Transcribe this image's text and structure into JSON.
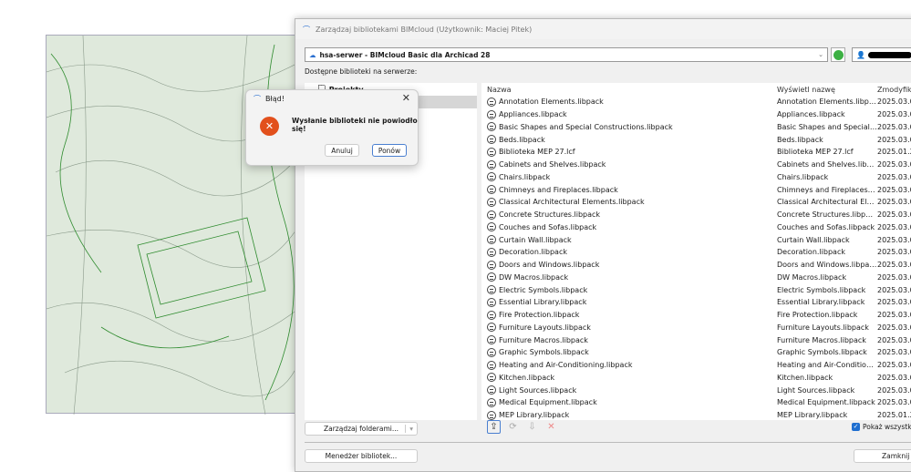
{
  "window": {
    "title": "Zarządzaj bibliotekami BIMcloud (Użytkownik: Maciej Pitek)"
  },
  "server": {
    "value": "hsa-serwer - BIMcloud Basic dla Archicad 28"
  },
  "available_label": "Dostępne biblioteki na serwerze:",
  "tree": {
    "root": "Projekty"
  },
  "columns": {
    "name": "Nazwa",
    "display": "Wyświetl nazwę",
    "modified": "Zmodyfik"
  },
  "libraries": [
    {
      "name": "Annotation Elements.libpack",
      "display": "Annotation Elements.libpack",
      "modified": "2025.03.0"
    },
    {
      "name": "Appliances.libpack",
      "display": "Appliances.libpack",
      "modified": "2025.03.0"
    },
    {
      "name": "Basic Shapes and Special Constructions.libpack",
      "display": "Basic Shapes and Special Cons...",
      "modified": "2025.03.0"
    },
    {
      "name": "Beds.libpack",
      "display": "Beds.libpack",
      "modified": "2025.03.0"
    },
    {
      "name": "Biblioteka MEP 27.lcf",
      "display": "Biblioteka MEP 27.lcf",
      "modified": "2025.01.2"
    },
    {
      "name": "Cabinets and Shelves.libpack",
      "display": "Cabinets and Shelves.libpack",
      "modified": "2025.03.0"
    },
    {
      "name": "Chairs.libpack",
      "display": "Chairs.libpack",
      "modified": "2025.03.0"
    },
    {
      "name": "Chimneys and Fireplaces.libpack",
      "display": "Chimneys and Fireplaces.libpack",
      "modified": "2025.03.0"
    },
    {
      "name": "Classical Architectural Elements.libpack",
      "display": "Classical Architectural Element...",
      "modified": "2025.03.0"
    },
    {
      "name": "Concrete Structures.libpack",
      "display": "Concrete Structures.libpack",
      "modified": "2025.03.0"
    },
    {
      "name": "Couches and Sofas.libpack",
      "display": "Couches and Sofas.libpack",
      "modified": "2025.03.0"
    },
    {
      "name": "Curtain Wall.libpack",
      "display": "Curtain Wall.libpack",
      "modified": "2025.03.0"
    },
    {
      "name": "Decoration.libpack",
      "display": "Decoration.libpack",
      "modified": "2025.03.0"
    },
    {
      "name": "Doors and Windows.libpack",
      "display": "Doors and Windows.libpack",
      "modified": "2025.03.0"
    },
    {
      "name": "DW Macros.libpack",
      "display": "DW Macros.libpack",
      "modified": "2025.03.0"
    },
    {
      "name": "Electric Symbols.libpack",
      "display": "Electric Symbols.libpack",
      "modified": "2025.03.0"
    },
    {
      "name": "Essential Library.libpack",
      "display": "Essential Library.libpack",
      "modified": "2025.03.0"
    },
    {
      "name": "Fire Protection.libpack",
      "display": "Fire Protection.libpack",
      "modified": "2025.03.0"
    },
    {
      "name": "Furniture Layouts.libpack",
      "display": "Furniture Layouts.libpack",
      "modified": "2025.03.0"
    },
    {
      "name": "Furniture Macros.libpack",
      "display": "Furniture Macros.libpack",
      "modified": "2025.03.0"
    },
    {
      "name": "Graphic Symbols.libpack",
      "display": "Graphic Symbols.libpack",
      "modified": "2025.03.0"
    },
    {
      "name": "Heating and Air-Conditioning.libpack",
      "display": "Heating and Air-Conditioning....",
      "modified": "2025.03.0"
    },
    {
      "name": "Kitchen.libpack",
      "display": "Kitchen.libpack",
      "modified": "2025.03.0"
    },
    {
      "name": "Light Sources.libpack",
      "display": "Light Sources.libpack",
      "modified": "2025.03.0"
    },
    {
      "name": "Medical Equipment.libpack",
      "display": "Medical Equipment.libpack",
      "modified": "2025.03.0"
    },
    {
      "name": "MEP Library.libpack",
      "display": "MEP Library.libpack",
      "modified": "2025.01.2"
    }
  ],
  "buttons": {
    "manage_folders": "Zarządzaj folderami...",
    "library_manager": "Menedżer bibliotek...",
    "close": "Zamknij",
    "show_all": "Pokaż wszystko"
  },
  "error_dialog": {
    "title": "Błąd!",
    "message": "Wysłanie biblioteki nie powiodło się!",
    "cancel": "Anuluj",
    "retry": "Ponów"
  }
}
